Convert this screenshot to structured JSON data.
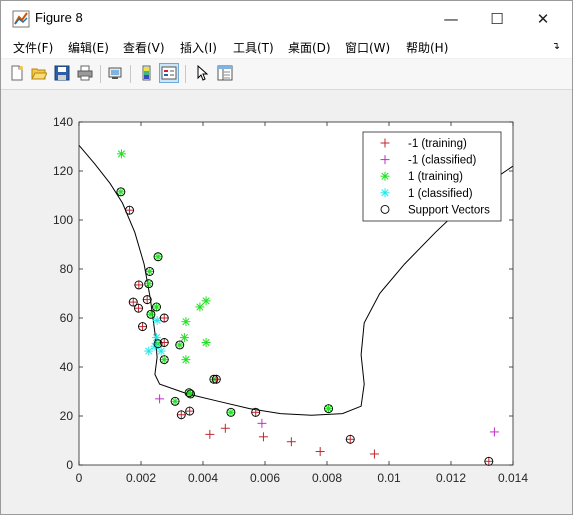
{
  "window": {
    "title": "Figure 8",
    "controls": {
      "minimize": "—",
      "maximize": "☐",
      "close": "✕"
    }
  },
  "menu": {
    "items": [
      "文件(F)",
      "编辑(E)",
      "查看(V)",
      "插入(I)",
      "工具(T)",
      "桌面(D)",
      "窗口(W)",
      "帮助(H)"
    ]
  },
  "toolbar": {
    "buttons": [
      "new-figure-icon",
      "open-file-icon",
      "save-icon",
      "print-icon",
      "link-icon",
      "colorbar-icon",
      "legend-icon",
      "pointer-icon",
      "property-inspector-icon"
    ]
  },
  "chart_data": {
    "type": "scatter",
    "title": "",
    "xlabel": "",
    "ylabel": "",
    "xlim": [
      0,
      0.014
    ],
    "ylim": [
      0,
      140
    ],
    "xticks": [
      0,
      0.002,
      0.004,
      0.006,
      0.008,
      0.01,
      0.012,
      0.014
    ],
    "xtick_labels": [
      "0",
      "0.002",
      "0.004",
      "0.006",
      "0.008",
      "0.01",
      "0.012",
      "0.014"
    ],
    "yticks": [
      0,
      20,
      40,
      60,
      80,
      100,
      120,
      140
    ],
    "ytick_labels": [
      "0",
      "20",
      "40",
      "60",
      "80",
      "100",
      "120",
      "140"
    ],
    "grid": false,
    "legend_position": "top-right",
    "series": [
      {
        "name": "-1 (training)",
        "marker": "+",
        "color": "#c1272d",
        "points": [
          [
            0.00163,
            104
          ],
          [
            0.00193,
            73.5
          ],
          [
            0.00175,
            66.5
          ],
          [
            0.0022,
            67.5
          ],
          [
            0.00192,
            64
          ],
          [
            0.00205,
            56.5
          ],
          [
            0.00275,
            60
          ],
          [
            0.00275,
            50
          ],
          [
            0.00443,
            35
          ],
          [
            0.0033,
            20.5
          ],
          [
            0.00357,
            22
          ],
          [
            0.00422,
            12.5
          ],
          [
            0.00472,
            15
          ],
          [
            0.0057,
            21.5
          ],
          [
            0.00595,
            11.5
          ],
          [
            0.00685,
            9.5
          ],
          [
            0.00778,
            5.5
          ],
          [
            0.00875,
            10.5
          ],
          [
            0.00953,
            4.5
          ],
          [
            0.01322,
            1.5
          ]
        ]
      },
      {
        "name": "-1 (classified)",
        "marker": "+",
        "color": "#c12ec8",
        "points": [
          [
            0.0026,
            27
          ],
          [
            0.0059,
            17
          ],
          [
            0.0134,
            13.5
          ]
        ]
      },
      {
        "name": "1 (training)",
        "marker": "*",
        "color": "#22e022",
        "points": [
          [
            0.00137,
            127
          ],
          [
            0.00135,
            111.5
          ],
          [
            0.00255,
            85
          ],
          [
            0.00228,
            79
          ],
          [
            0.00225,
            74
          ],
          [
            0.0025,
            64.5
          ],
          [
            0.00232,
            61.5
          ],
          [
            0.00345,
            58.5
          ],
          [
            0.0039,
            64.5
          ],
          [
            0.0041,
            67
          ],
          [
            0.0034,
            52
          ],
          [
            0.0041,
            50
          ],
          [
            0.00325,
            49
          ],
          [
            0.00255,
            49.5
          ],
          [
            0.00275,
            43
          ],
          [
            0.00345,
            43
          ],
          [
            0.00355,
            29.5
          ],
          [
            0.0036,
            29
          ],
          [
            0.00435,
            35
          ],
          [
            0.0031,
            26
          ],
          [
            0.0049,
            21.5
          ],
          [
            0.00805,
            23
          ]
        ]
      },
      {
        "name": "1 (classified)",
        "marker": "*",
        "color": "#22e8e8",
        "points": [
          [
            0.00252,
            59
          ],
          [
            0.0025,
            52
          ],
          [
            0.00245,
            48.5
          ],
          [
            0.00225,
            46.5
          ],
          [
            0.00265,
            46.5
          ]
        ]
      },
      {
        "name": "Support Vectors",
        "marker": "o",
        "color": "#000000",
        "points": [
          [
            0.00135,
            111.5
          ],
          [
            0.00163,
            104
          ],
          [
            0.00255,
            85
          ],
          [
            0.00228,
            79
          ],
          [
            0.00193,
            73.5
          ],
          [
            0.00225,
            74
          ],
          [
            0.0022,
            67.5
          ],
          [
            0.00175,
            66.5
          ],
          [
            0.00192,
            64
          ],
          [
            0.0025,
            64.5
          ],
          [
            0.00232,
            61.5
          ],
          [
            0.00275,
            60
          ],
          [
            0.00205,
            56.5
          ],
          [
            0.00275,
            50
          ],
          [
            0.00325,
            49
          ],
          [
            0.00255,
            49.5
          ],
          [
            0.00275,
            43
          ],
          [
            0.00355,
            29.5
          ],
          [
            0.0036,
            29
          ],
          [
            0.00435,
            35
          ],
          [
            0.00443,
            35
          ],
          [
            0.0031,
            26
          ],
          [
            0.0033,
            20.5
          ],
          [
            0.00357,
            22
          ],
          [
            0.0049,
            21.5
          ],
          [
            0.0057,
            21.5
          ],
          [
            0.00805,
            23
          ],
          [
            0.00875,
            10.5
          ],
          [
            0.01322,
            1.5
          ]
        ]
      }
    ],
    "boundary": [
      [
        0,
        130.5
      ],
      [
        0.0005,
        123
      ],
      [
        0.001,
        115
      ],
      [
        0.0014,
        107
      ],
      [
        0.0018,
        95
      ],
      [
        0.0021,
        82
      ],
      [
        0.0023,
        68
      ],
      [
        0.00245,
        54
      ],
      [
        0.00252,
        44
      ],
      [
        0.00245,
        37
      ],
      [
        0.0026,
        33
      ],
      [
        0.0035,
        29
      ],
      [
        0.0045,
        26
      ],
      [
        0.0055,
        23
      ],
      [
        0.0065,
        21
      ],
      [
        0.0075,
        20.3
      ],
      [
        0.0085,
        21
      ],
      [
        0.0091,
        24
      ],
      [
        0.0092,
        33
      ],
      [
        0.0091,
        45
      ],
      [
        0.0092,
        58
      ],
      [
        0.0097,
        70
      ],
      [
        0.0105,
        82
      ],
      [
        0.0115,
        95
      ],
      [
        0.0125,
        107
      ],
      [
        0.0133,
        116
      ],
      [
        0.014,
        122
      ]
    ]
  }
}
